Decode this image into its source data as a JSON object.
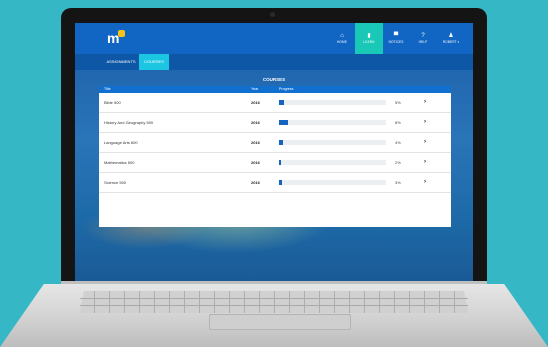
{
  "app": {
    "logo": "m"
  },
  "nav": [
    {
      "icon": "home-icon",
      "glyph": "⌂",
      "label": "HOME",
      "active": false
    },
    {
      "icon": "learn-icon",
      "glyph": "▮",
      "label": "LEARN",
      "active": true
    },
    {
      "icon": "notices-icon",
      "glyph": "▀",
      "label": "NOTICES",
      "active": false
    },
    {
      "icon": "help-icon",
      "glyph": "?",
      "label": "HELP",
      "active": false
    },
    {
      "icon": "user-icon",
      "glyph": "♟",
      "label": "ROBERT ▾",
      "active": false
    }
  ],
  "tabs": {
    "assignments": "ASSIGNMENTS",
    "courses": "COURSES"
  },
  "page_title": "COURSES",
  "table": {
    "headers": {
      "title": "Title",
      "year": "Year",
      "progress": "Progress"
    },
    "rows": [
      {
        "title": "Bible 500",
        "year": "2016",
        "progress": 5,
        "pct": "5%"
      },
      {
        "title": "History And Geography 500",
        "year": "2016",
        "progress": 8,
        "pct": "8%"
      },
      {
        "title": "Language Arts 600",
        "year": "2016",
        "progress": 4,
        "pct": "4%"
      },
      {
        "title": "Mathematics 500",
        "year": "2016",
        "progress": 2,
        "pct": "2%"
      },
      {
        "title": "Science 500",
        "year": "2016",
        "progress": 3,
        "pct": "3%"
      }
    ]
  },
  "colors": {
    "background": "#36b7c6",
    "topbar": "#1166c4",
    "active_nav": "#19c8b7",
    "active_tab": "#1cc6e2",
    "progress": "#1565c0"
  }
}
